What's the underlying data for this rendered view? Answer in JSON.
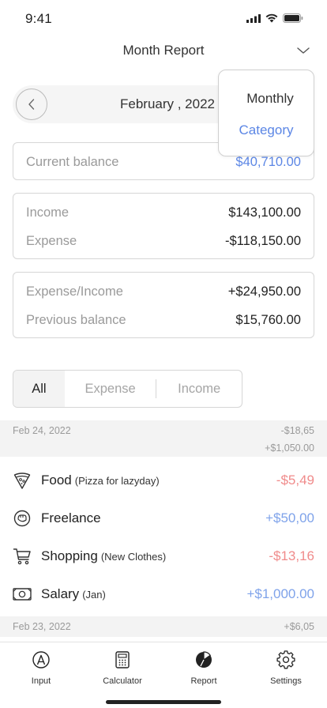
{
  "status": {
    "time": "9:41"
  },
  "header": {
    "title": "Month Report"
  },
  "date_selector": {
    "label": "February , 2022"
  },
  "dropdown": {
    "options": [
      "Monthly",
      "Category"
    ],
    "selected": "Category"
  },
  "summary": {
    "current_balance": {
      "label": "Current balance",
      "value": "$40,710.00"
    },
    "income": {
      "label": "Income",
      "value": "$143,100.00"
    },
    "expense": {
      "label": "Expense",
      "value": "-$118,150.00"
    },
    "expense_income": {
      "label": "Expense/Income",
      "value": "+$24,950.00"
    },
    "previous_balance": {
      "label": "Previous balance",
      "value": "$15,760.00"
    }
  },
  "filter_tabs": [
    "All",
    "Expense",
    "Income"
  ],
  "days": [
    {
      "date": "Feb 24, 2022",
      "expense_total": "-$18,65",
      "income_total": "+$1,050.00",
      "transactions": [
        {
          "icon": "pizza-icon",
          "name": "Food",
          "note": "(Pizza for lazyday)",
          "amount": "-$5,49"
        },
        {
          "icon": "freelance-icon",
          "name": "Freelance",
          "note": "",
          "amount": "+$50,00"
        },
        {
          "icon": "cart-icon",
          "name": "Shopping",
          "note": "(New Clothes)",
          "amount": "-$13,16"
        },
        {
          "icon": "cash-icon",
          "name": "Salary",
          "note": "(Jan)",
          "amount": "+$1,000.00"
        }
      ]
    },
    {
      "date": "Feb 23, 2022",
      "total": "+$6,05"
    }
  ],
  "tabbar": {
    "items": [
      {
        "label": "Input",
        "icon": "input-icon"
      },
      {
        "label": "Calculator",
        "icon": "calculator-icon"
      },
      {
        "label": "Report",
        "icon": "report-pie-icon"
      },
      {
        "label": "Settings",
        "icon": "gear-icon"
      }
    ]
  },
  "colors": {
    "accent": "#5b86e5",
    "negative": "#f08b8b",
    "positive": "#7fa3ea"
  }
}
